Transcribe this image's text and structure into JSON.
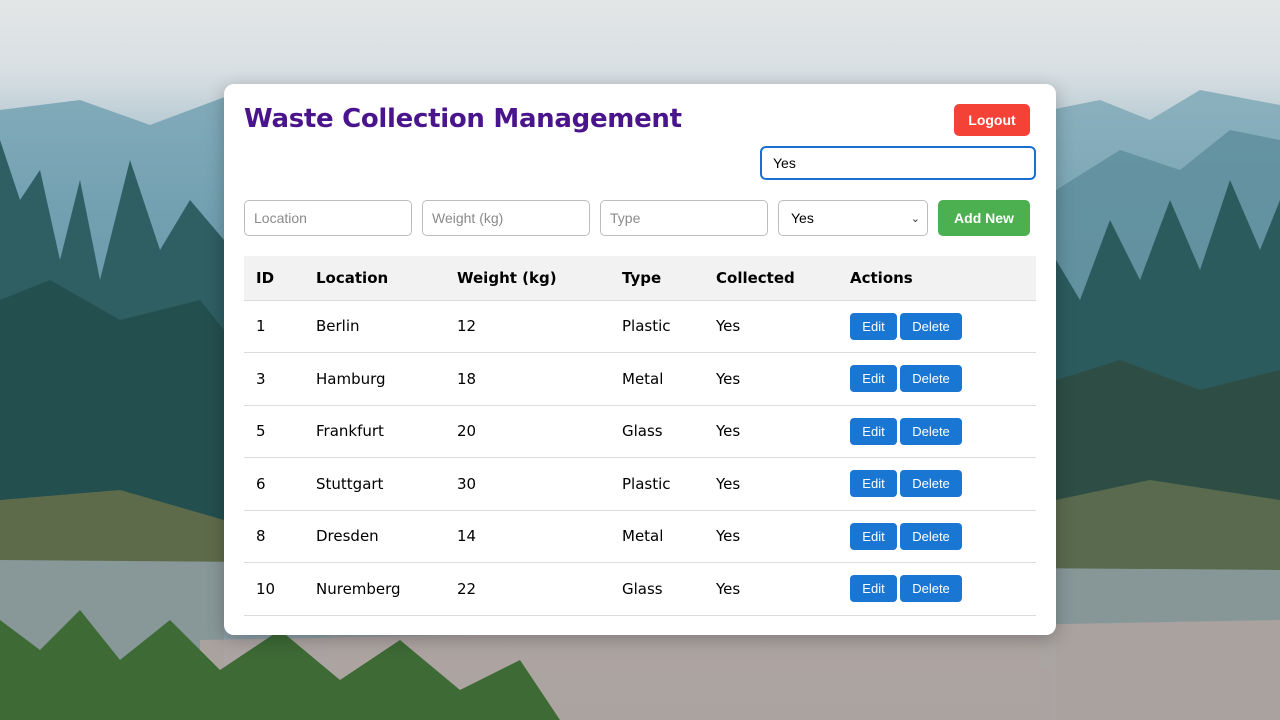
{
  "header": {
    "title": "Waste Collection Management",
    "logout_label": "Logout"
  },
  "search": {
    "value": "Yes"
  },
  "form": {
    "location_placeholder": "Location",
    "weight_placeholder": "Weight (kg)",
    "type_placeholder": "Type",
    "collected_selected": "Yes",
    "add_label": "Add New"
  },
  "table": {
    "headers": [
      "ID",
      "Location",
      "Weight (kg)",
      "Type",
      "Collected",
      "Actions"
    ],
    "edit_label": "Edit",
    "delete_label": "Delete",
    "rows": [
      {
        "id": "1",
        "location": "Berlin",
        "weight": "12",
        "type": "Plastic",
        "collected": "Yes"
      },
      {
        "id": "3",
        "location": "Hamburg",
        "weight": "18",
        "type": "Metal",
        "collected": "Yes"
      },
      {
        "id": "5",
        "location": "Frankfurt",
        "weight": "20",
        "type": "Glass",
        "collected": "Yes"
      },
      {
        "id": "6",
        "location": "Stuttgart",
        "weight": "30",
        "type": "Plastic",
        "collected": "Yes"
      },
      {
        "id": "8",
        "location": "Dresden",
        "weight": "14",
        "type": "Metal",
        "collected": "Yes"
      },
      {
        "id": "10",
        "location": "Nuremberg",
        "weight": "22",
        "type": "Glass",
        "collected": "Yes"
      }
    ]
  },
  "colors": {
    "title": "#4a148c",
    "logout": "#f44336",
    "add": "#4caf50",
    "action": "#1976d2"
  },
  "icons": {
    "select_arrow": "chevron-down-icon"
  }
}
